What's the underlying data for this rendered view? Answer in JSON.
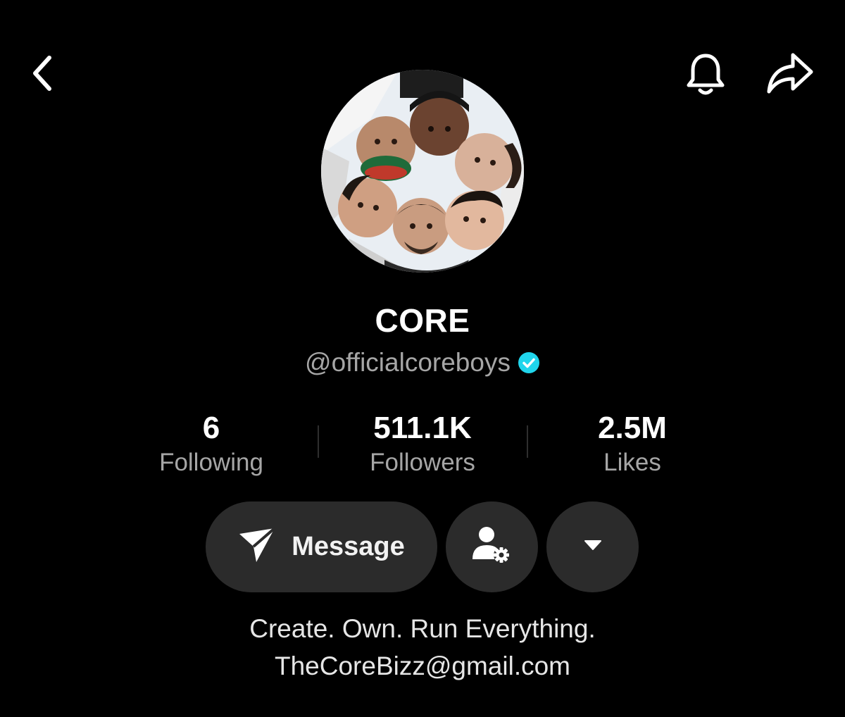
{
  "header": {
    "back_icon": "chevron-left-icon",
    "bell_icon": "bell-icon",
    "share_icon": "share-arrow-icon"
  },
  "profile": {
    "display_name": "CORE",
    "handle": "@officialcoreboys",
    "verified": true,
    "verified_color": "#20d5ec"
  },
  "stats": [
    {
      "value": "6",
      "label": "Following"
    },
    {
      "value": "511.1K",
      "label": "Followers"
    },
    {
      "value": "2.5M",
      "label": "Likes"
    }
  ],
  "actions": {
    "message_label": "Message",
    "message_icon": "paper-plane-icon",
    "add_friend_icon": "user-gear-icon",
    "dropdown_icon": "caret-down-icon"
  },
  "bio": {
    "line1": "Create. Own. Run Everything.",
    "line2": "TheCoreBizz@gmail.com"
  }
}
